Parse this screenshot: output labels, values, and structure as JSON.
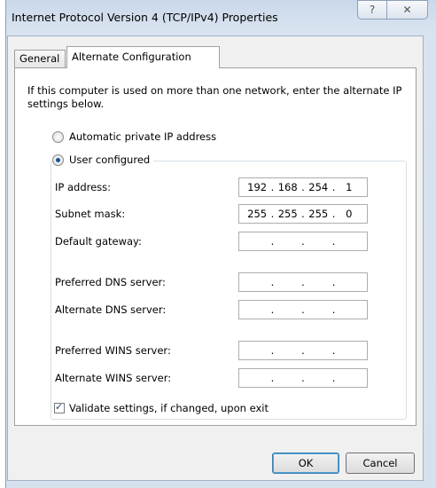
{
  "window": {
    "title": "Internet Protocol Version 4 (TCP/IPv4) Properties",
    "help_glyph": "?",
    "close_glyph": "✕"
  },
  "tabs": [
    {
      "label": "General",
      "active": false
    },
    {
      "label": "Alternate Configuration",
      "active": true
    }
  ],
  "description": "If this computer is used on more than one network, enter the alternate IP settings below.",
  "radios": {
    "automatic": {
      "label": "Automatic private IP address",
      "checked": false
    },
    "user": {
      "label": "User configured",
      "checked": true
    }
  },
  "fields": {
    "ip_address": {
      "label": "IP address:",
      "octets": [
        "192",
        "168",
        "254",
        "1"
      ]
    },
    "subnet_mask": {
      "label": "Subnet mask:",
      "octets": [
        "255",
        "255",
        "255",
        "0"
      ]
    },
    "default_gateway": {
      "label": "Default gateway:",
      "octets": [
        "",
        "",
        "",
        ""
      ]
    },
    "preferred_dns": {
      "label": "Preferred DNS server:",
      "octets": [
        "",
        "",
        "",
        ""
      ]
    },
    "alternate_dns": {
      "label": "Alternate DNS server:",
      "octets": [
        "",
        "",
        "",
        ""
      ]
    },
    "preferred_wins": {
      "label": "Preferred WINS server:",
      "octets": [
        "",
        "",
        "",
        ""
      ]
    },
    "alternate_wins": {
      "label": "Alternate WINS server:",
      "octets": [
        "",
        "",
        "",
        ""
      ]
    }
  },
  "validate": {
    "label": "Validate settings, if changed, upon exit",
    "checked": true
  },
  "buttons": {
    "ok": "OK",
    "cancel": "Cancel"
  },
  "colors": {
    "selected_radio": "#1f4f9a",
    "frame": "#d6e1ee",
    "panel": "#ffffff"
  }
}
